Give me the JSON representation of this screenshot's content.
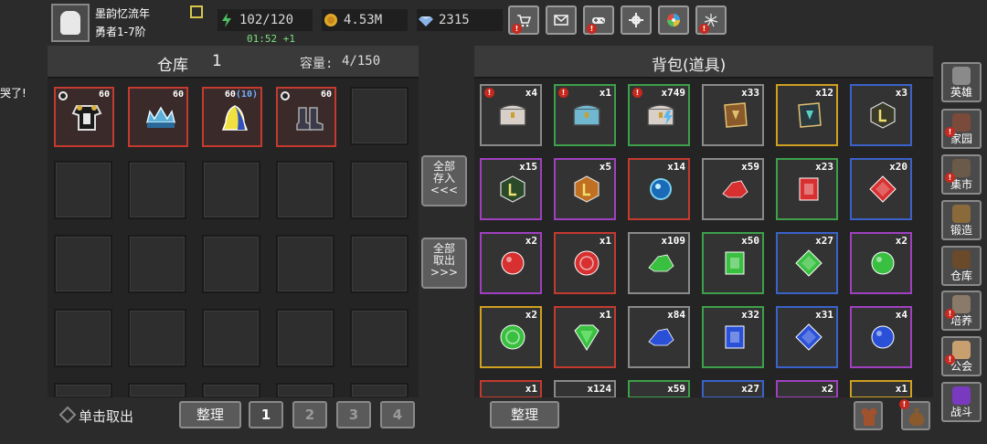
{
  "player": {
    "name": "墨韵忆流年",
    "rank": "勇者1-7阶"
  },
  "stats": {
    "energy": "102/120",
    "energy_timer": "01:52 +1",
    "gold": "4.53M",
    "gems": "2315"
  },
  "toolbar": {
    "icons": [
      "shop-icon",
      "mail-icon",
      "gamepad-icon",
      "gear-icon",
      "wheel-icon",
      "fireworks-icon"
    ]
  },
  "left_cut_text": "哭了!",
  "warehouse": {
    "title": "仓库",
    "page": "1",
    "capacity_label": "容量:",
    "capacity_value": "4/150",
    "items": [
      {
        "name": "armor",
        "count": "60",
        "extra": ""
      },
      {
        "name": "crown",
        "count": "60",
        "extra": ""
      },
      {
        "name": "bell-cape",
        "count": "60",
        "extra": "(10)"
      },
      {
        "name": "boots",
        "count": "60",
        "extra": ""
      }
    ],
    "take_out_label": "单击取出",
    "sort_label": "整理",
    "pages": [
      "1",
      "2",
      "3",
      "4"
    ]
  },
  "transfer": {
    "store_all": [
      "全部",
      "存入",
      "<<<"
    ],
    "take_all": [
      "全部",
      "取出",
      ">>>"
    ]
  },
  "backpack": {
    "title": "背包(道具)",
    "sort_label": "整理",
    "items": [
      {
        "count": "x4",
        "color": "#8a8a8a",
        "icon": "white-chest-icon",
        "alert": true
      },
      {
        "count": "x1",
        "color": "#3ea04a",
        "icon": "blue-chest-icon",
        "alert": true
      },
      {
        "count": "x749",
        "color": "#3ea04a",
        "icon": "lightning-chest-icon",
        "alert": true
      },
      {
        "count": "x33",
        "color": "#8a8a8a",
        "icon": "brown-book-icon",
        "alert": false
      },
      {
        "count": "x12",
        "color": "#d0a020",
        "icon": "dark-book-icon",
        "alert": false
      },
      {
        "count": "x3",
        "color": "#3a62c8",
        "icon": "rune-stone-icon",
        "alert": false
      },
      {
        "count": "x15",
        "color": "#a040c0",
        "icon": "green-rune-icon",
        "alert": false
      },
      {
        "count": "x5",
        "color": "#a040c0",
        "icon": "amber-rune-icon",
        "alert": false
      },
      {
        "count": "x14",
        "color": "#c43a30",
        "icon": "blue-orb-icon",
        "alert": false
      },
      {
        "count": "x59",
        "color": "#8a8a8a",
        "icon": "red-shard-icon",
        "alert": false
      },
      {
        "count": "x23",
        "color": "#3ea04a",
        "icon": "red-square-gem-icon",
        "alert": false
      },
      {
        "count": "x20",
        "color": "#3a62c8",
        "icon": "red-diamond-gem-icon",
        "alert": false
      },
      {
        "count": "x2",
        "color": "#a040c0",
        "icon": "red-round-gem-icon",
        "alert": false
      },
      {
        "count": "x1",
        "color": "#c43a30",
        "icon": "red-cut-gem-icon",
        "alert": false
      },
      {
        "count": "x109",
        "color": "#8a8a8a",
        "icon": "green-shard-icon",
        "alert": false
      },
      {
        "count": "x50",
        "color": "#3ea04a",
        "icon": "green-square-gem-icon",
        "alert": false
      },
      {
        "count": "x27",
        "color": "#3a62c8",
        "icon": "green-diamond-gem-icon",
        "alert": false
      },
      {
        "count": "x2",
        "color": "#a040c0",
        "icon": "green-round-gem-icon",
        "alert": false
      },
      {
        "count": "x2",
        "color": "#d0a020",
        "icon": "green-cut-gem-icon",
        "alert": false
      },
      {
        "count": "x1",
        "color": "#c43a30",
        "icon": "big-green-gem-icon",
        "alert": false
      },
      {
        "count": "x84",
        "color": "#8a8a8a",
        "icon": "blue-shard-icon",
        "alert": false
      },
      {
        "count": "x32",
        "color": "#3ea04a",
        "icon": "blue-square-gem-icon",
        "alert": false
      },
      {
        "count": "x31",
        "color": "#3a62c8",
        "icon": "blue-diamond-gem-icon",
        "alert": false
      },
      {
        "count": "x4",
        "color": "#a040c0",
        "icon": "blue-round-gem-icon",
        "alert": false
      },
      {
        "count": "x1",
        "color": "#c43a30",
        "icon": "partial-item-icon",
        "alert": false
      },
      {
        "count": "x124",
        "color": "#8a8a8a",
        "icon": "partial-item-icon",
        "alert": false
      },
      {
        "count": "x59",
        "color": "#3ea04a",
        "icon": "partial-item-icon",
        "alert": false
      },
      {
        "count": "x27",
        "color": "#3a62c8",
        "icon": "partial-item-icon",
        "alert": false
      },
      {
        "count": "x2",
        "color": "#a040c0",
        "icon": "partial-item-icon",
        "alert": false
      },
      {
        "count": "x1",
        "color": "#d0a020",
        "icon": "partial-item-icon",
        "alert": false
      }
    ]
  },
  "sidebar": [
    {
      "label": "英雄",
      "icon": "helmet-icon",
      "alert": false
    },
    {
      "label": "家园",
      "icon": "castle-icon",
      "alert": true
    },
    {
      "label": "集市",
      "icon": "market-icon",
      "alert": true
    },
    {
      "label": "锻造",
      "icon": "anvil-icon",
      "alert": false
    },
    {
      "label": "仓库",
      "icon": "warehouse-icon",
      "alert": false
    },
    {
      "label": "培养",
      "icon": "training-icon",
      "alert": true
    },
    {
      "label": "公会",
      "icon": "guild-icon",
      "alert": true
    },
    {
      "label": "战斗",
      "icon": "battle-portal-icon",
      "alert": false
    }
  ]
}
